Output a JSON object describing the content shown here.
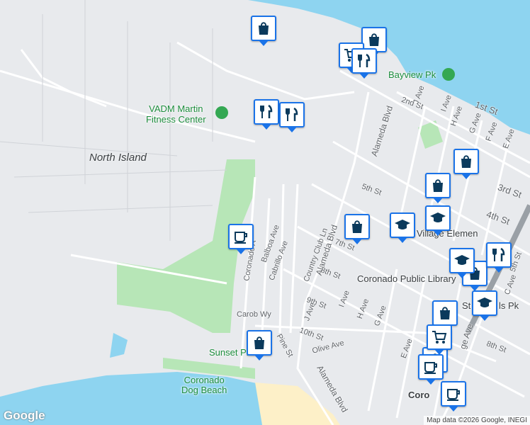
{
  "map": {
    "colors": {
      "water": "#8ed4f0",
      "land": "#e8eaed",
      "park": "#b7e6b7",
      "sand": "#fdf0c8",
      "road": "#ffffff",
      "pin_border": "#1a73e8",
      "pin_icon": "#0b3a5c",
      "poi_green": "#1e8e3e"
    },
    "labels": {
      "north_island": "North Island",
      "fitness": "VADM Martin Fitness Center",
      "fitness_line1": "VADM Martin",
      "fitness_line2": "Fitness Center",
      "bayview": "Bayview Pk",
      "coronado_library": "Coronado Public Library",
      "sunset": "Sunset Pk",
      "dog_beach_1": "Coronado",
      "dog_beach_2": "Dog Beach",
      "village_elem": "Village Elemen",
      "st_pk": "St",
      "st_pk2": "ls Pk",
      "coro": "Coro"
    },
    "streets": {
      "alameda_blvd": "Alameda Blvd",
      "first_st": "1st St",
      "second_st": "2nd St",
      "third_st": "3rd St",
      "fourth_st": "4th St",
      "fifth_st": "5th St",
      "fifth_st_b": "5th St",
      "seventh_st": "7th St",
      "eighth_st": "8th St",
      "eighth_st_b": "8th St",
      "ninth_st": "9th St",
      "tenth_st": "10th St",
      "j_ave": "J Ave",
      "j_ave_b": "J Ave",
      "i_ave": "I Ave",
      "i_ave_b": "I Ave",
      "h_ave": "H Ave",
      "h_ave_b": "H Ave",
      "g_ave": "G Ave",
      "g_ave_b": "G Ave",
      "f_ave": "F Ave",
      "e_ave": "E Ave",
      "e_ave_b": "E Ave",
      "c_ave": "C Ave",
      "ge_ave": "ge Ave",
      "coronado_ave": "Coronado A",
      "balboa": "Balboa Ave",
      "cabrillo": "Cabrillo Ave",
      "country_club": "Country Club Ln",
      "carob": "Carob Wy",
      "pine": "Pine St",
      "olive": "Olive Ave"
    },
    "pins": [
      {
        "name": "shopping-pin-1",
        "icon": "bag"
      },
      {
        "name": "shopping-pin-2",
        "icon": "bag"
      },
      {
        "name": "cart-pin-1",
        "icon": "cart"
      },
      {
        "name": "restaurant-pin-1",
        "icon": "food"
      },
      {
        "name": "restaurant-pin-2",
        "icon": "food"
      },
      {
        "name": "restaurant-pin-3",
        "icon": "food"
      },
      {
        "name": "shopping-pin-3",
        "icon": "bag"
      },
      {
        "name": "shopping-pin-4",
        "icon": "bag"
      },
      {
        "name": "school-pin-1",
        "icon": "school"
      },
      {
        "name": "school-pin-2",
        "icon": "school"
      },
      {
        "name": "shopping-pin-5",
        "icon": "bag"
      },
      {
        "name": "cafe-pin-1",
        "icon": "cafe"
      },
      {
        "name": "shopping-pin-6",
        "icon": "bag"
      },
      {
        "name": "restaurant-pin-4",
        "icon": "food"
      },
      {
        "name": "school-pin-3",
        "icon": "school"
      },
      {
        "name": "shopping-pin-7",
        "icon": "bag"
      },
      {
        "name": "school-pin-4",
        "icon": "school"
      },
      {
        "name": "shopping-pin-8",
        "icon": "bag"
      },
      {
        "name": "cart-pin-2",
        "icon": "cart"
      },
      {
        "name": "cafe-pin-2",
        "icon": "cafe"
      },
      {
        "name": "cafe-pin-3",
        "icon": "cafe"
      },
      {
        "name": "shopping-pin-9",
        "icon": "bag"
      }
    ],
    "logo": "Google",
    "attribution": "Map data ©2026 Google, INEGI"
  }
}
